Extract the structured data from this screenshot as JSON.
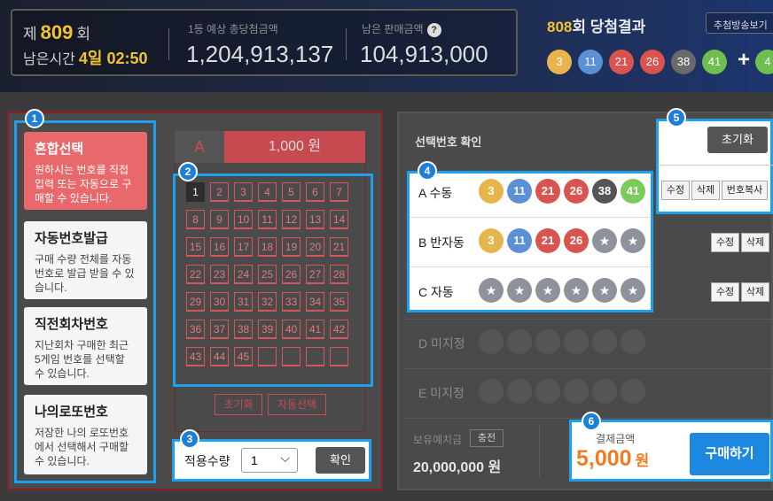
{
  "header": {
    "draw_prefix": "제",
    "draw_no": "809",
    "draw_suffix": "회",
    "time_label": "남은시간",
    "time_value": "4일 02:50",
    "prize_label": "1등 예상 총당첨금액",
    "prize_value": "1,204,913,137",
    "remain_label": "남은 판매금액",
    "remain_icon": "question-icon",
    "remain_value": "104,913,000",
    "result_no": "808",
    "result_suffix": "회 당첨결과",
    "broadcast_label": "추첨방송보기",
    "result_balls": [
      {
        "n": "3",
        "color": "#e8b54d"
      },
      {
        "n": "11",
        "color": "#5b8fd6"
      },
      {
        "n": "21",
        "color": "#d9534f"
      },
      {
        "n": "26",
        "color": "#d9534f"
      },
      {
        "n": "38",
        "color": "#6a6a6a"
      },
      {
        "n": "41",
        "color": "#6fbf4f"
      }
    ],
    "plus": "+",
    "bonus_ball": {
      "n": "4",
      "color": "#6fbf4f"
    }
  },
  "badges": [
    "1",
    "2",
    "3",
    "4",
    "5",
    "6"
  ],
  "select_types": [
    {
      "title": "혼합선택",
      "desc": "원하시는 번호를 직접 입력 또는 자동으로 구매할 수 있습니다."
    },
    {
      "title": "자동번호발급",
      "desc": "구매 수량 전체를 자동 번호로 발급 받을 수 있습니다."
    },
    {
      "title": "직전회차번호",
      "desc": "지난회차 구매한 최근 5게임 번호를 선택할 수 있습니다."
    },
    {
      "title": "나의로또번호",
      "desc": "저장한 나의 로또번호에서 선택해서 구매할 수 있습니다."
    }
  ],
  "game": {
    "label": "A",
    "price": "1,000 원",
    "selected": 1
  },
  "numbers": [
    "1",
    "2",
    "3",
    "4",
    "5",
    "6",
    "7",
    "8",
    "9",
    "10",
    "11",
    "12",
    "13",
    "14",
    "15",
    "16",
    "17",
    "18",
    "19",
    "20",
    "21",
    "22",
    "23",
    "24",
    "25",
    "26",
    "27",
    "28",
    "29",
    "30",
    "31",
    "32",
    "33",
    "34",
    "35",
    "36",
    "37",
    "38",
    "39",
    "40",
    "41",
    "42",
    "43",
    "44",
    "45"
  ],
  "grid_buttons": {
    "reset": "초기화",
    "auto": "자동선택"
  },
  "quantity": {
    "label": "적용수량",
    "value": "1",
    "confirm": "확인"
  },
  "confirm_panel": {
    "title": "선택번호 확인",
    "reset": "초기화",
    "row_buttons": {
      "edit": "수정",
      "delete": "삭제",
      "copy": "번호복사"
    },
    "rows": [
      {
        "label": "A 수동",
        "balls": [
          {
            "n": "3",
            "color": "#e8b54d"
          },
          {
            "n": "11",
            "color": "#5b8fd6"
          },
          {
            "n": "21",
            "color": "#d9534f"
          },
          {
            "n": "26",
            "color": "#d9534f"
          },
          {
            "n": "38",
            "color": "#555555"
          },
          {
            "n": "41",
            "color": "#7cc95c"
          }
        ]
      },
      {
        "label": "B 반자동",
        "balls": [
          {
            "n": "3",
            "color": "#e8b54d"
          },
          {
            "n": "11",
            "color": "#5b8fd6"
          },
          {
            "n": "21",
            "color": "#d9534f"
          },
          {
            "n": "26",
            "color": "#d9534f"
          },
          {
            "n": "★",
            "color": "#8e939b"
          },
          {
            "n": "★",
            "color": "#8e939b"
          }
        ]
      },
      {
        "label": "C 자동",
        "balls": [
          {
            "n": "★",
            "color": "#8e939b"
          },
          {
            "n": "★",
            "color": "#8e939b"
          },
          {
            "n": "★",
            "color": "#8e939b"
          },
          {
            "n": "★",
            "color": "#8e939b"
          },
          {
            "n": "★",
            "color": "#8e939b"
          },
          {
            "n": "★",
            "color": "#8e939b"
          }
        ]
      },
      {
        "label": "D 미지정",
        "balls": []
      },
      {
        "label": "E 미지정",
        "balls": []
      }
    ]
  },
  "deposit": {
    "label": "보유예치금",
    "charge": "충전",
    "value": "20,000,000 원"
  },
  "payment": {
    "label": "결제금액",
    "amount": "5,000",
    "unit": "원",
    "buy": "구매하기"
  }
}
